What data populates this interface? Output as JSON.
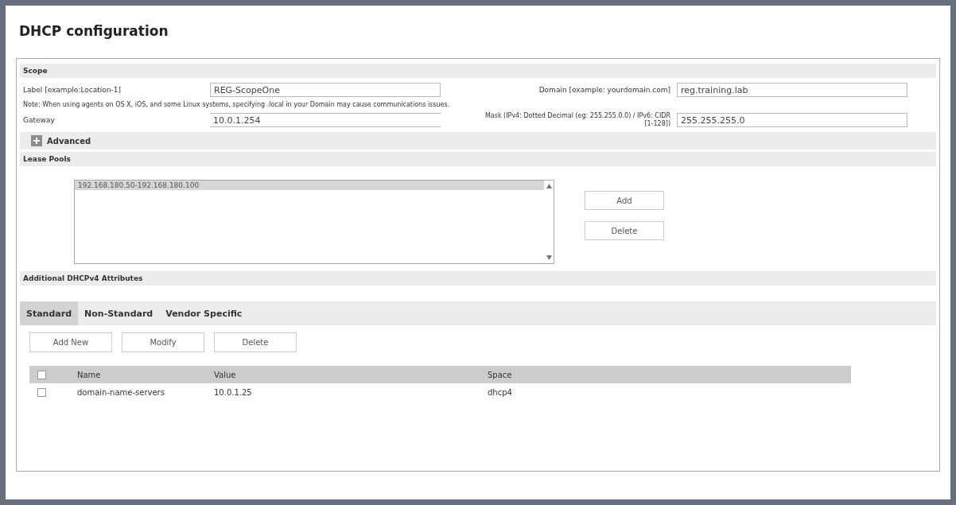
{
  "title": "DHCP configuration",
  "scope": {
    "heading": "Scope",
    "label_field": {
      "label": "Label [example:Location-1]",
      "value": "REG-ScopeOne"
    },
    "domain_field": {
      "label": "Domain [example: yourdomain.com]",
      "value": "reg.training.lab"
    },
    "note": "Note: When using agents on OS X, iOS, and some Linux systems, specifying .local in your Domain may cause communications issues.",
    "gateway_field": {
      "label": "Gateway",
      "value": "10.0.1.254"
    },
    "mask_field": {
      "label": "Mask (IPv4: Dotted Decimal (eg: 255.255.0.0) / IPv6: CIDR [1-128])",
      "value": "255.255.255.0"
    },
    "advanced": {
      "label": "Advanced",
      "expanded": false
    }
  },
  "lease_pools": {
    "heading": "Lease Pools",
    "items": [
      {
        "text": "192.168.180.50-192.168.180.100",
        "selected": true
      }
    ],
    "buttons": [
      "Add",
      "Delete"
    ]
  },
  "attributes": {
    "heading": "Additional DHCPv4 Attributes",
    "tabs": [
      {
        "label": "Standard",
        "selected": true
      },
      {
        "label": "Non-Standard",
        "selected": false
      },
      {
        "label": "Vendor Specific",
        "selected": false
      }
    ],
    "buttons": [
      "Add New",
      "Modify",
      "Delete"
    ],
    "table": {
      "header_checked": false,
      "columns": [
        "Name",
        "Value",
        "Space"
      ],
      "rows": [
        {
          "checked": false,
          "cells": [
            "domain-name-servers",
            "10.0.1.25",
            "dhcp4"
          ]
        }
      ]
    }
  }
}
